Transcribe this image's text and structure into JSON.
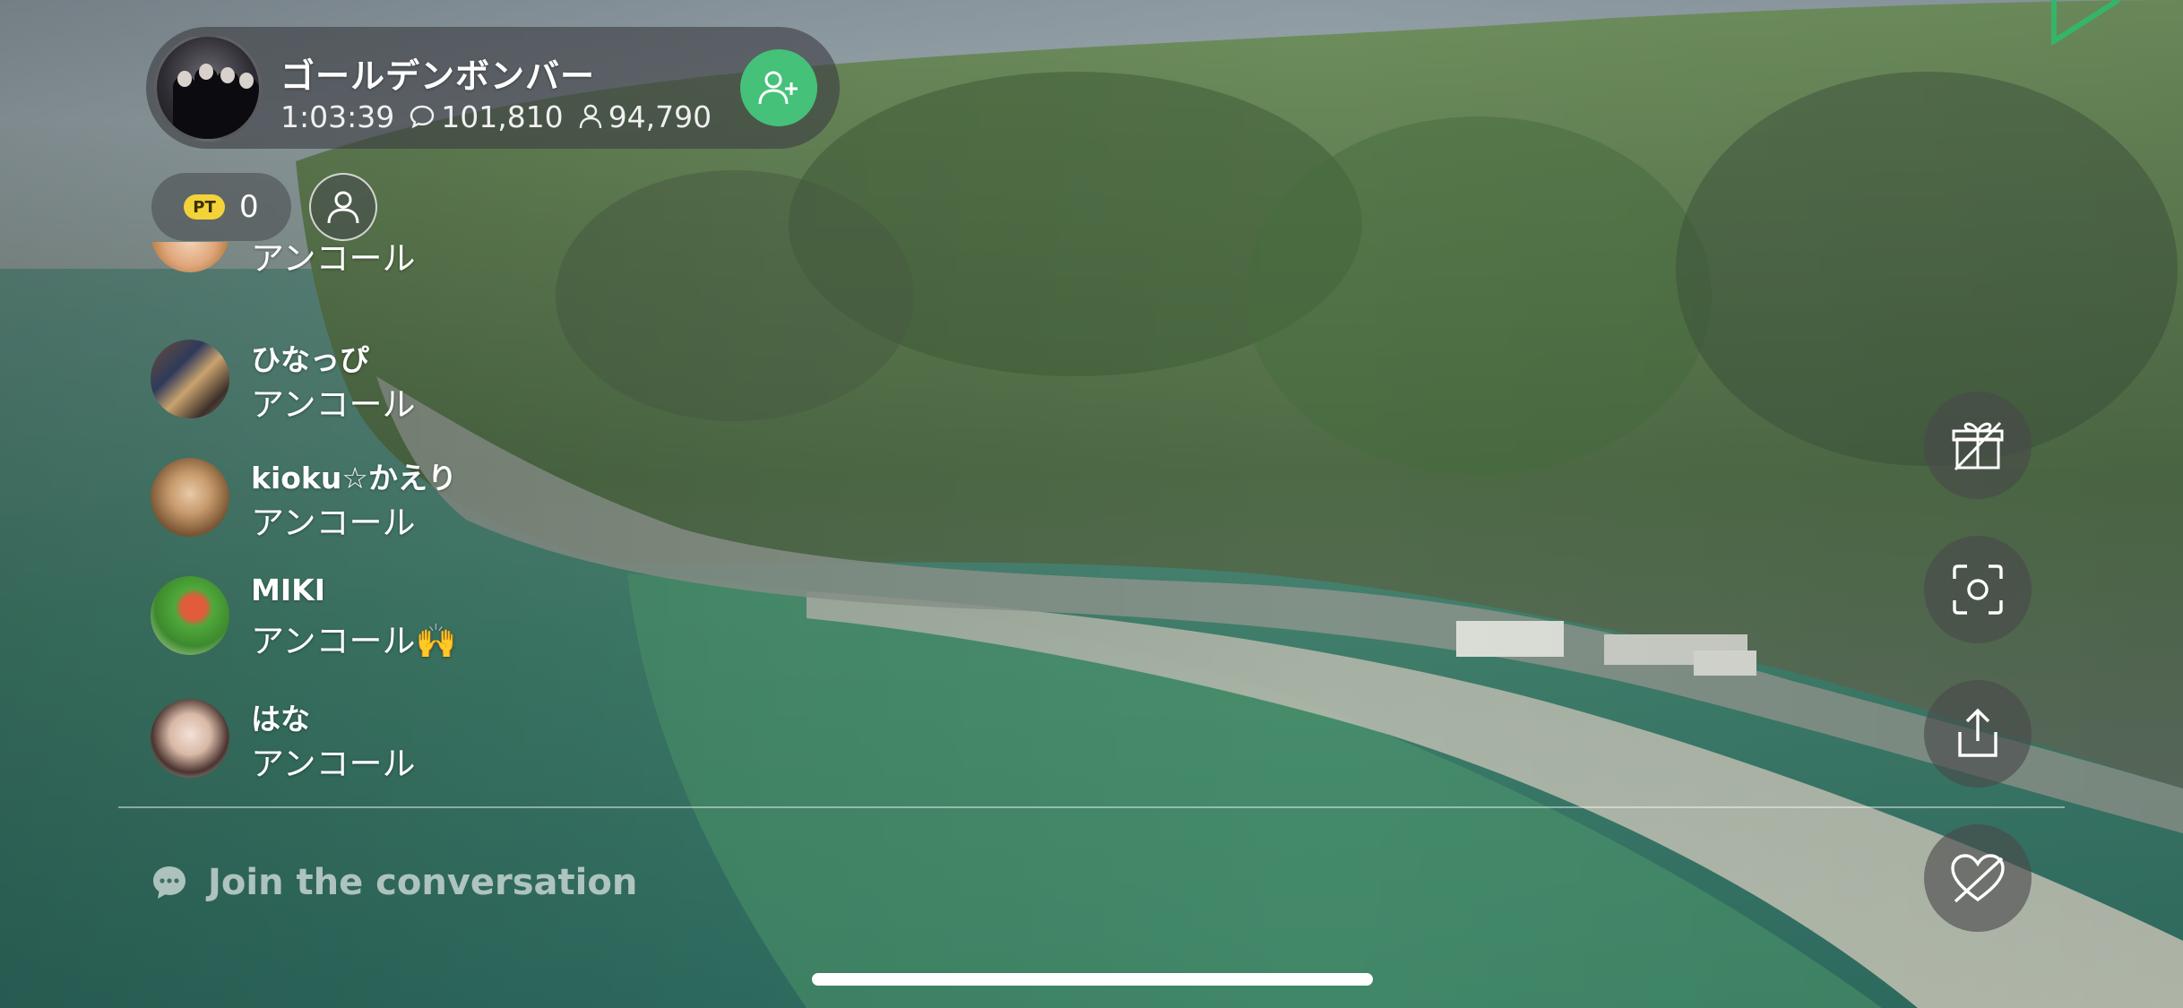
{
  "header": {
    "channel_name": "ゴールデンボンバー",
    "elapsed_time": "1:03:39",
    "comment_count": "101,810",
    "viewer_count": "94,790",
    "follow_icon": "add-user-icon"
  },
  "points": {
    "badge": "PT",
    "value": "0"
  },
  "profile_icon": "user-icon",
  "comments": [
    {
      "user": "",
      "text": "アンコール"
    },
    {
      "user": "ひなっぴ",
      "text": "アンコール"
    },
    {
      "user": "kioku☆かえり",
      "text": "アンコール"
    },
    {
      "user": "MIKI",
      "text": "アンコール🙌"
    },
    {
      "user": "はな",
      "text": "アンコール"
    }
  ],
  "input": {
    "placeholder": "Join the conversation",
    "icon": "chat-bubble-icon"
  },
  "actions": [
    {
      "icon": "gift-icon"
    },
    {
      "icon": "screenshot-icon"
    },
    {
      "icon": "share-icon"
    },
    {
      "icon": "heart-icon"
    }
  ],
  "colors": {
    "follow_green": "#45c179",
    "pt_badge_yellow": "#f3d23a",
    "overlay_dark": "rgba(60,62,66,0.62)"
  }
}
